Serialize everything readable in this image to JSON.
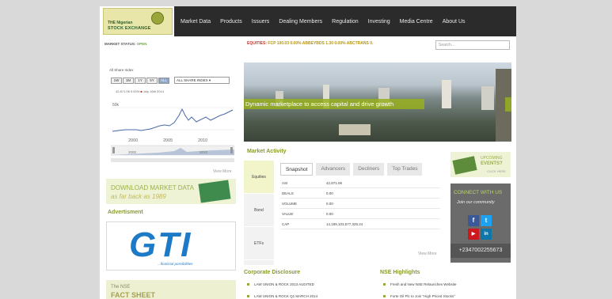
{
  "logo": {
    "line1": "THE Nigerian",
    "line2": "STOCK EXCHANGE"
  },
  "nav": [
    "Market Data",
    "Products",
    "Issuers",
    "Dealing Members",
    "Regulation",
    "Investing",
    "Media Centre",
    "About Us"
  ],
  "status": {
    "label": "MARKET STATUS:",
    "value": "OPEN"
  },
  "ticker": {
    "head": "EQUITIES:",
    "text": "FCP 100.03 0.00%",
    "rest": "ABBEYBDS 1.30 0.00%   ABCTRANS 0."
  },
  "search": {
    "placeholder": "Search..."
  },
  "index": {
    "title": "All Share Index",
    "ranges": [
      "1W",
      "1M",
      "1Y",
      "5Y",
      "ALL"
    ],
    "selected_range": "ALL",
    "select": "ALL SHARE INDEX",
    "value_line": "42,871.06 0.00%",
    "value_date": "July 16th 2014",
    "ytick": "50k",
    "xticks": [
      "2000",
      "2005",
      "2010"
    ],
    "nav_xticks": [
      "2000",
      "2010"
    ],
    "view_more": "View More"
  },
  "download_banner": {
    "line1": "DOWNLOAD MARKET DATA",
    "line2": "as far back as 1989"
  },
  "advert": {
    "title": "Advertisment",
    "brand": "GTI",
    "tagline": "...financial possibilities"
  },
  "fact_banner": {
    "line1": "The NSE",
    "line2": "FACT SHEET"
  },
  "hero": {
    "caption": "Dynamic marketplace to access capital and drive growth"
  },
  "market_activity": {
    "title": "Market Activity",
    "side_tabs": [
      "Equities",
      "Bond",
      "ETFs"
    ],
    "active_side": "Equities",
    "tabs": [
      "Snapshot",
      "Advancers",
      "Decliners",
      "Top Trades"
    ],
    "active_tab": "Snapshot",
    "rows": [
      {
        "key": "ASI",
        "value": "42,871.06"
      },
      {
        "key": "DEALS",
        "value": "0.00"
      },
      {
        "key": "VOLUME",
        "value": "0.00"
      },
      {
        "key": "VALUE",
        "value": "0.00"
      },
      {
        "key": "CAP",
        "value": "14,189,103,577,325.24"
      }
    ],
    "view_more": "View More"
  },
  "upcoming": {
    "line1": "UPCOMING",
    "line2": "EVENTS?",
    "line3": "CLICK HERE"
  },
  "connect": {
    "title": "CONNECT WITH US",
    "subtitle": "Join our community",
    "phone": "+2347002255673",
    "socials": [
      {
        "letter": "f",
        "color": "#3b5998"
      },
      {
        "letter": "t",
        "color": "#1da1f2"
      },
      {
        "letter": "▶",
        "color": "#cc181e"
      },
      {
        "letter": "in",
        "color": "#0e76a8"
      }
    ]
  },
  "corporate": {
    "title": "Corporate Disclosure",
    "items": [
      "LAW UNION & ROCK 2013 AUDITED",
      "LAW UNION & ROCK Q1 MARCH 2014"
    ]
  },
  "highlights": {
    "title": "NSE Highlights",
    "items": [
      "Fresh and New NSE Relaunches Website",
      "Forte Oil Plc to Join \"High Priced Stocks\""
    ]
  }
}
